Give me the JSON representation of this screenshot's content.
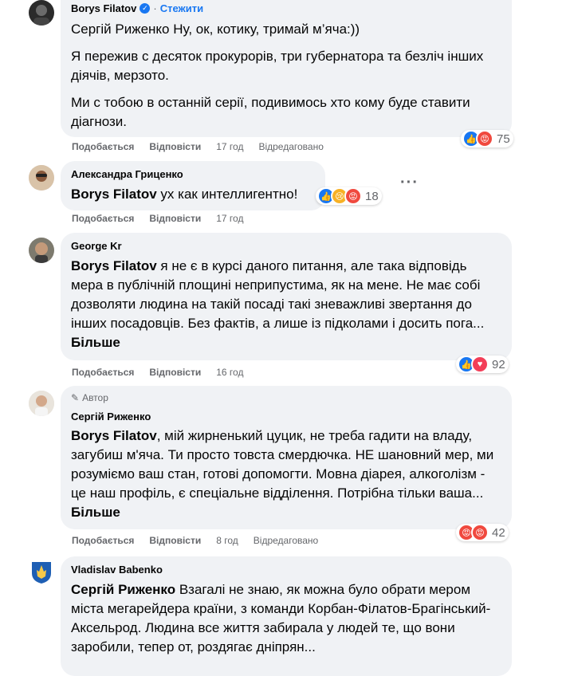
{
  "comments": [
    {
      "author": "Borys Filatov",
      "follow": "Стежити",
      "paragraphs": [
        "Сергій Риженко Ну, ок, котику, тримай м’яча:))",
        "Я пережив с десяток прокурорів, три губернатора та безліч інших діячів, мерзото.",
        "Ми с тобою в останній серії, подивимось хто кому буде ставити діагнози."
      ],
      "like": "Подобається",
      "reply": "Відповісти",
      "time": "17 год",
      "edited": "Відредаговано",
      "reactions": [
        "like-icon",
        "angry-icon"
      ],
      "count": "75"
    },
    {
      "author": "Александра Гриценко",
      "mention": "Borys Filatov",
      "text": " ух как интеллигентно!",
      "like": "Подобається",
      "reply": "Відповісти",
      "time": "17 год",
      "reactions": [
        "like-icon",
        "sad-icon",
        "angry-icon"
      ],
      "count": "18",
      "options": "···"
    },
    {
      "author": "George Kr",
      "mention": "Borys Filatov",
      "text": " я не є в курсі даного питання, але така відповідь мера в публічній площині неприпустима, як на мене. Не має собі дозволяти людина на такій посаді такі зневажливі звертання до інших посадовців. Без фактів, а лише із підколами і досить пога...",
      "more": "Більше",
      "like": "Подобається",
      "reply": "Відповісти",
      "time": "16 год",
      "reactions": [
        "like-icon",
        "love-icon"
      ],
      "count": "92"
    },
    {
      "badge": "Автор",
      "author": "Сергій Риженко",
      "mention": "Borys Filatov",
      "text": ", мій жирненький цуцик, не треба гадити на владу, загубиш м'яча. Ти просто товста смердючка. НЕ шановний мер, ми розуміємо ваш стан, готові допомогти. Мовна діарея, алкоголізм - це наш профіль, є спеціальне відділення. Потрібна тільки ваша...",
      "more": "Більше",
      "like": "Подобається",
      "reply": "Відповісти",
      "time": "8 год",
      "edited": "Відредаговано",
      "reactions": [
        "angry-icon",
        "angry-icon"
      ],
      "count": "42"
    },
    {
      "author": "Vladislav Babenko",
      "mention": "Сергій Риженко",
      "text": " Взагалі не знаю, як можна було обрати мером міста мегарейдера країни, з команди Корбан-Філатов-Брагінський-Аксельрод. Людина все життя забирала у людей те, що вони заробили, тепер от, роздягає дніпрян..."
    }
  ],
  "colors": {
    "link": "#1877f2",
    "bubble": "#f0f2f5",
    "meta": "#65676b"
  }
}
